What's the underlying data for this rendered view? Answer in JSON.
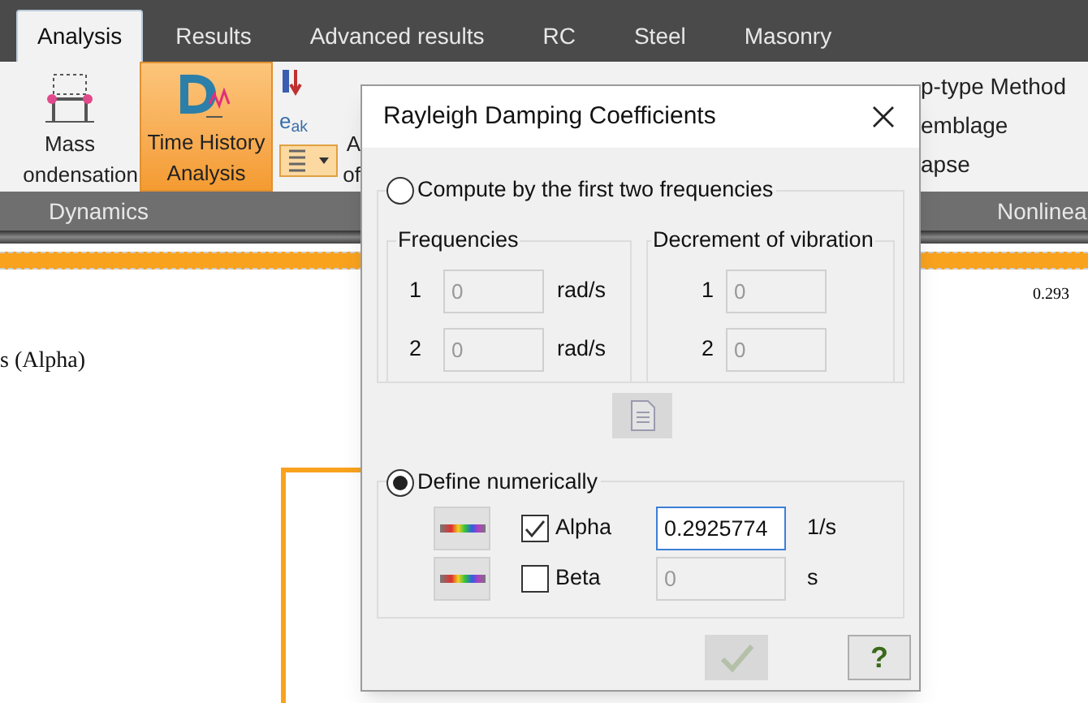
{
  "tabs": [
    {
      "label": "Analysis",
      "selected": true
    },
    {
      "label": "Results",
      "selected": false
    },
    {
      "label": "Advanced results",
      "selected": false
    },
    {
      "label": "RC",
      "selected": false
    },
    {
      "label": "Steel",
      "selected": false
    },
    {
      "label": "Masonry",
      "selected": false
    }
  ],
  "ribbon": {
    "mass_button": {
      "lines": [
        "Mass",
        "ondensation"
      ]
    },
    "time_history_button": {
      "lines": [
        "Time History",
        "Analysis"
      ],
      "selected": true
    },
    "small_label": "e$_{ak}$",
    "cut_button": {
      "lines": [
        "A",
        "of"
      ]
    },
    "right_items": [
      "p-type Method",
      "emblage",
      "apse"
    ],
    "groups": [
      "Dynamics",
      "Nonlinea"
    ]
  },
  "canvas": {
    "value_label": "0.293",
    "caption": "s (Alpha)"
  },
  "dialog": {
    "title": "Rayleigh Damping Coefficients",
    "compute_option": {
      "label": "Compute by the first two frequencies",
      "selected": false
    },
    "frequencies": {
      "title": "Frequencies",
      "rows": [
        {
          "index": "1",
          "value": "0",
          "unit": "rad/s"
        },
        {
          "index": "2",
          "value": "0",
          "unit": "rad/s"
        }
      ]
    },
    "decrement": {
      "title": "Decrement of vibration",
      "rows": [
        {
          "index": "1",
          "value": "0"
        },
        {
          "index": "2",
          "value": "0"
        }
      ]
    },
    "define_option": {
      "label": "Define numerically",
      "selected": true
    },
    "coefficients": [
      {
        "label": "Alpha",
        "checked": true,
        "value": "0.2925774",
        "unit": "1/s",
        "disabled": false
      },
      {
        "label": "Beta",
        "checked": false,
        "value": "0",
        "unit": "s",
        "disabled": true
      }
    ],
    "ok_disabled": true,
    "help": "?"
  }
}
